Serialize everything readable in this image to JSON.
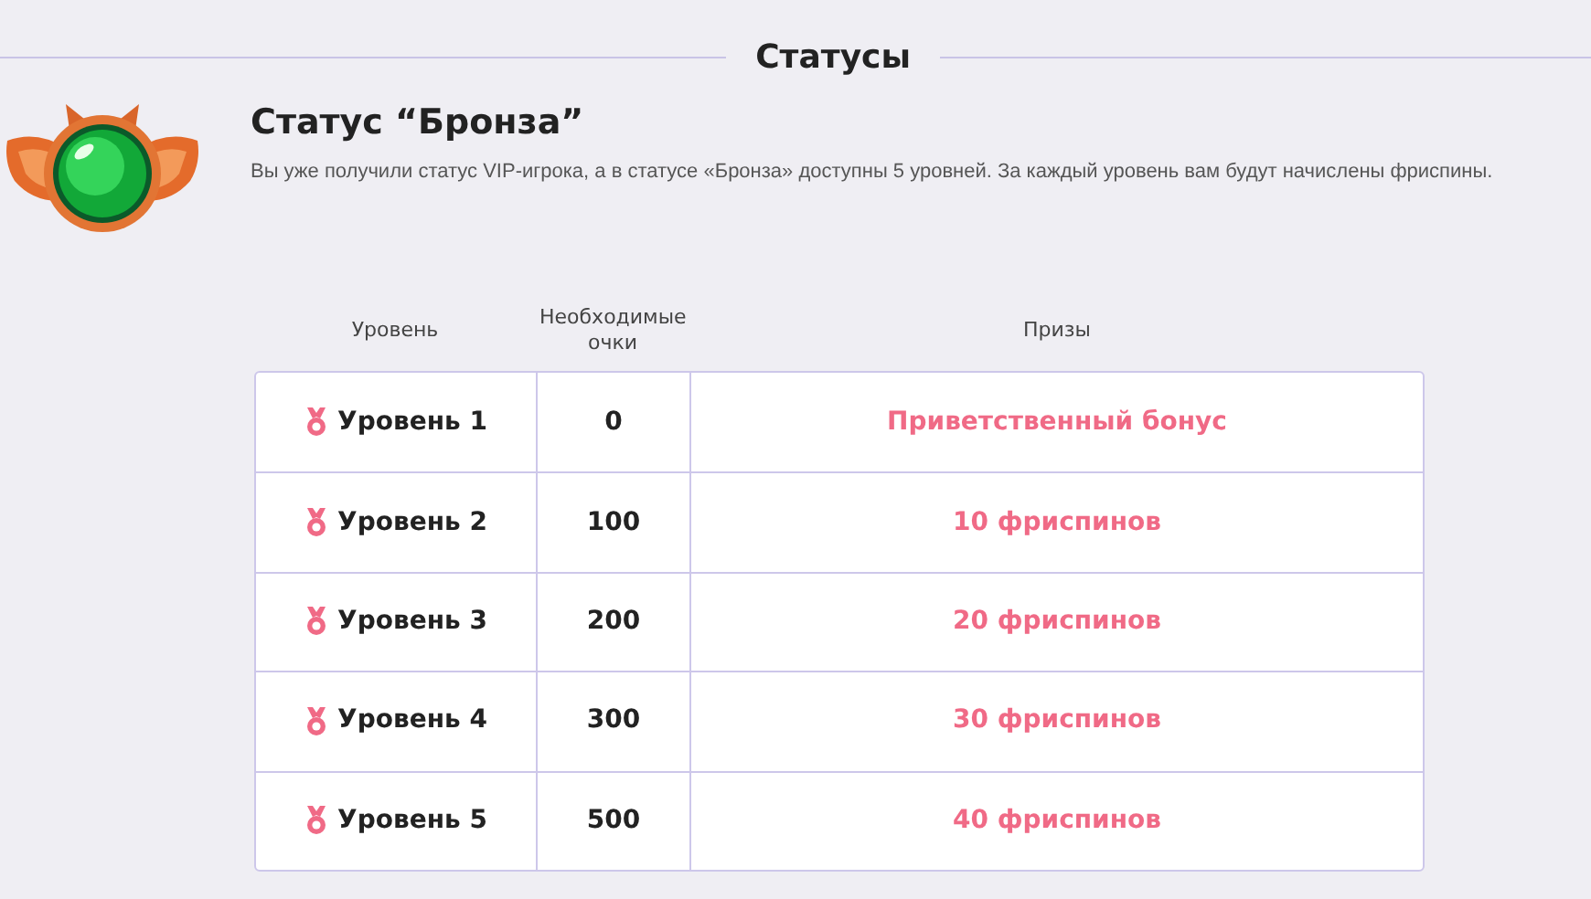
{
  "heading": "Статусы",
  "status": {
    "title": "Статус “Бронза”",
    "description": "Вы уже получили статус VIP-игрока, а в статусе «Бронза» доступны 5 уровней. За каждый уровень вам будут начислены фриспины."
  },
  "table": {
    "columns": [
      "Уровень",
      "Необходимые очки",
      "Призы"
    ],
    "rows": [
      {
        "level": "Уровень 1",
        "points": "0",
        "prize": "Приветственный бонус"
      },
      {
        "level": "Уровень 2",
        "points": "100",
        "prize": "10 фриспинов"
      },
      {
        "level": "Уровень 3",
        "points": "200",
        "prize": "20 фриспинов"
      },
      {
        "level": "Уровень 4",
        "points": "300",
        "prize": "30 фриспинов"
      },
      {
        "level": "Уровень 5",
        "points": "500",
        "prize": "40 фриспинов"
      }
    ]
  }
}
